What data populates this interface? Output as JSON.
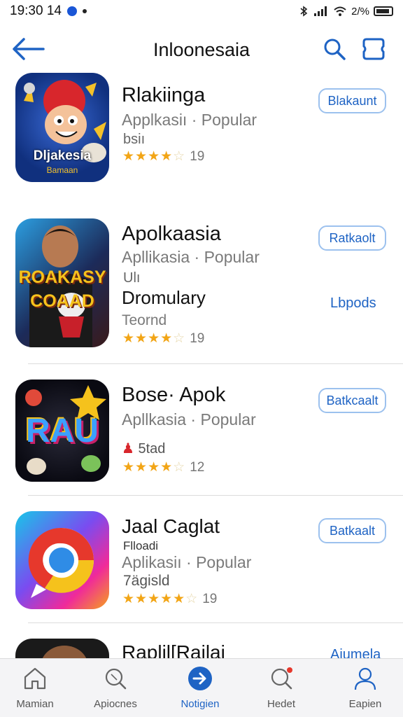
{
  "status_bar": {
    "time": "19:30 14",
    "battery_text": "2/%"
  },
  "nav": {
    "title": "Inloonesaia"
  },
  "apps": [
    {
      "name": "Rlakiinga",
      "subtitle": "Applkasiı · Popular",
      "extra": "bsiı",
      "stars_on": "★★★★",
      "stars_off": "☆",
      "count": "19",
      "button": "Blakaunt",
      "icon_text": "Dljakesia",
      "icon_subtext": "Bamaan"
    },
    {
      "name": "Apolkaasia",
      "subtitle": "Apllikasia · Popular",
      "extra": "Ulı",
      "extra2": "Dromulary",
      "extra3": "Teornd",
      "stars_on": "★★★★",
      "stars_off": "☆",
      "count": "19",
      "button": "Ratkaolt",
      "link": "Lbpods",
      "icon_text": "ROAKASY",
      "icon_subtext": "COAAD"
    },
    {
      "name": "Bose· Apok",
      "subtitle": "Apllkasia · Popular",
      "extra": "5tad",
      "stars_on": "★★★★",
      "stars_off": "☆",
      "count": "12",
      "button": "Batkcaalt",
      "icon_text": "RAU"
    },
    {
      "name": "Jaal Caglat",
      "subtitle": "Aplikasiı · Popular",
      "extra": "Flloadi",
      "extra2": "7ägisld",
      "stars_on": "★★★★★",
      "stars_off": "☆",
      "count": "19",
      "button": "Batkaalt"
    },
    {
      "name": "Raplil[Railai",
      "link": "Aiumela"
    }
  ],
  "tabs": [
    {
      "label": "Mamian",
      "icon": "home-icon"
    },
    {
      "label": "Apiocnes",
      "icon": "search-icon"
    },
    {
      "label": "Notigien",
      "icon": "forward-icon"
    },
    {
      "label": "Hedet",
      "icon": "search-notification-icon"
    },
    {
      "label": "Eapien",
      "icon": "user-icon"
    }
  ],
  "colors": {
    "accent": "#1e63c4",
    "star": "#f2a516",
    "tabbar_bg": "#f4f4f6"
  }
}
